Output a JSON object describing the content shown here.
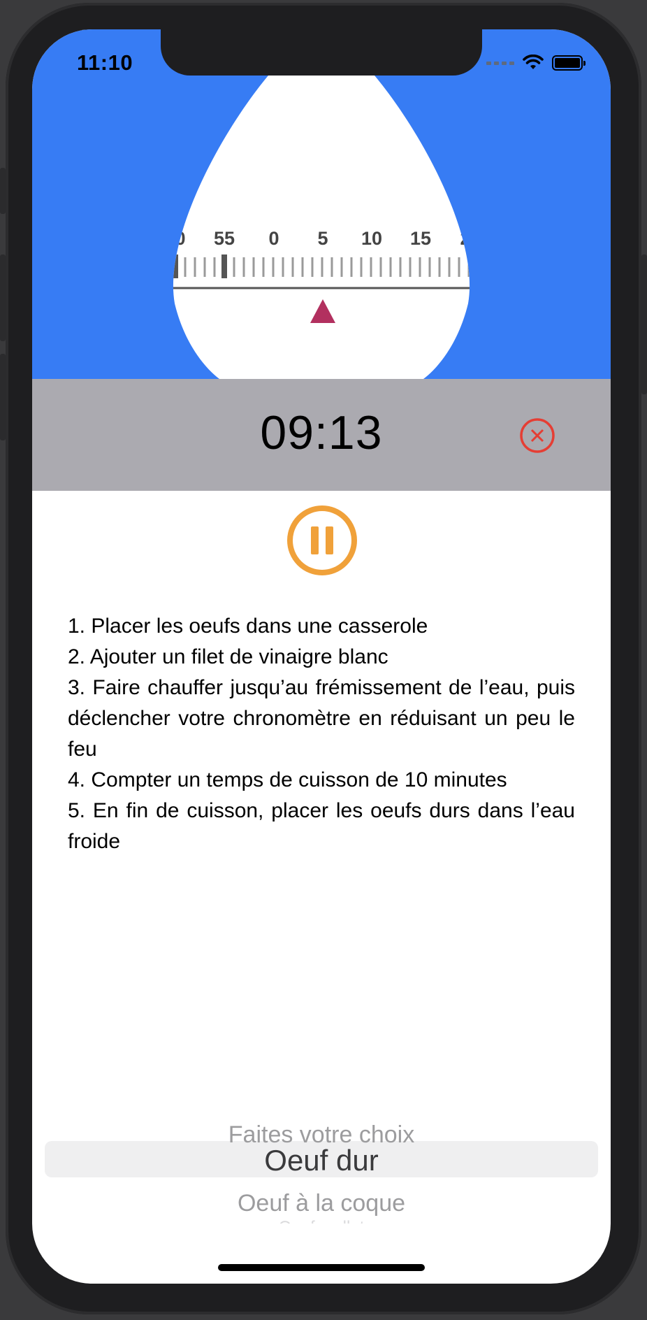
{
  "status_bar": {
    "time": "11:10",
    "icons": [
      "cellular-dots-icon",
      "wifi-icon",
      "battery-icon"
    ]
  },
  "colors": {
    "header_background": "#377cf4",
    "timer_bar_background": "#abaab0",
    "pointer": "#b2305f",
    "pause_accent": "#f0a13a",
    "cancel_accent": "#e53e34"
  },
  "dial": {
    "labels": [
      "0",
      "55",
      "0",
      "5",
      "10",
      "15",
      "2"
    ]
  },
  "timer": {
    "value": "09:13",
    "cancel_icon": "close-circle-icon",
    "pause_icon": "pause-circle-icon"
  },
  "instructions": [
    "1. Placer les oeufs dans une casserole",
    "2. Ajouter un filet de vinaigre blanc",
    "3. Faire chauffer jusqu’au frémissement de l’eau, puis déclencher votre chronomètre en réduisant un peu le feu",
    "4. Compter un temps de cuisson de 10 minutes",
    "5. En fin de cuisson, placer les oeufs durs dans l’eau froide"
  ],
  "picker": {
    "items": [
      "Faites votre choix",
      "Oeuf dur",
      "Oeuf à la coque",
      "Oeuf mollet"
    ],
    "selected": "Oeuf dur"
  }
}
